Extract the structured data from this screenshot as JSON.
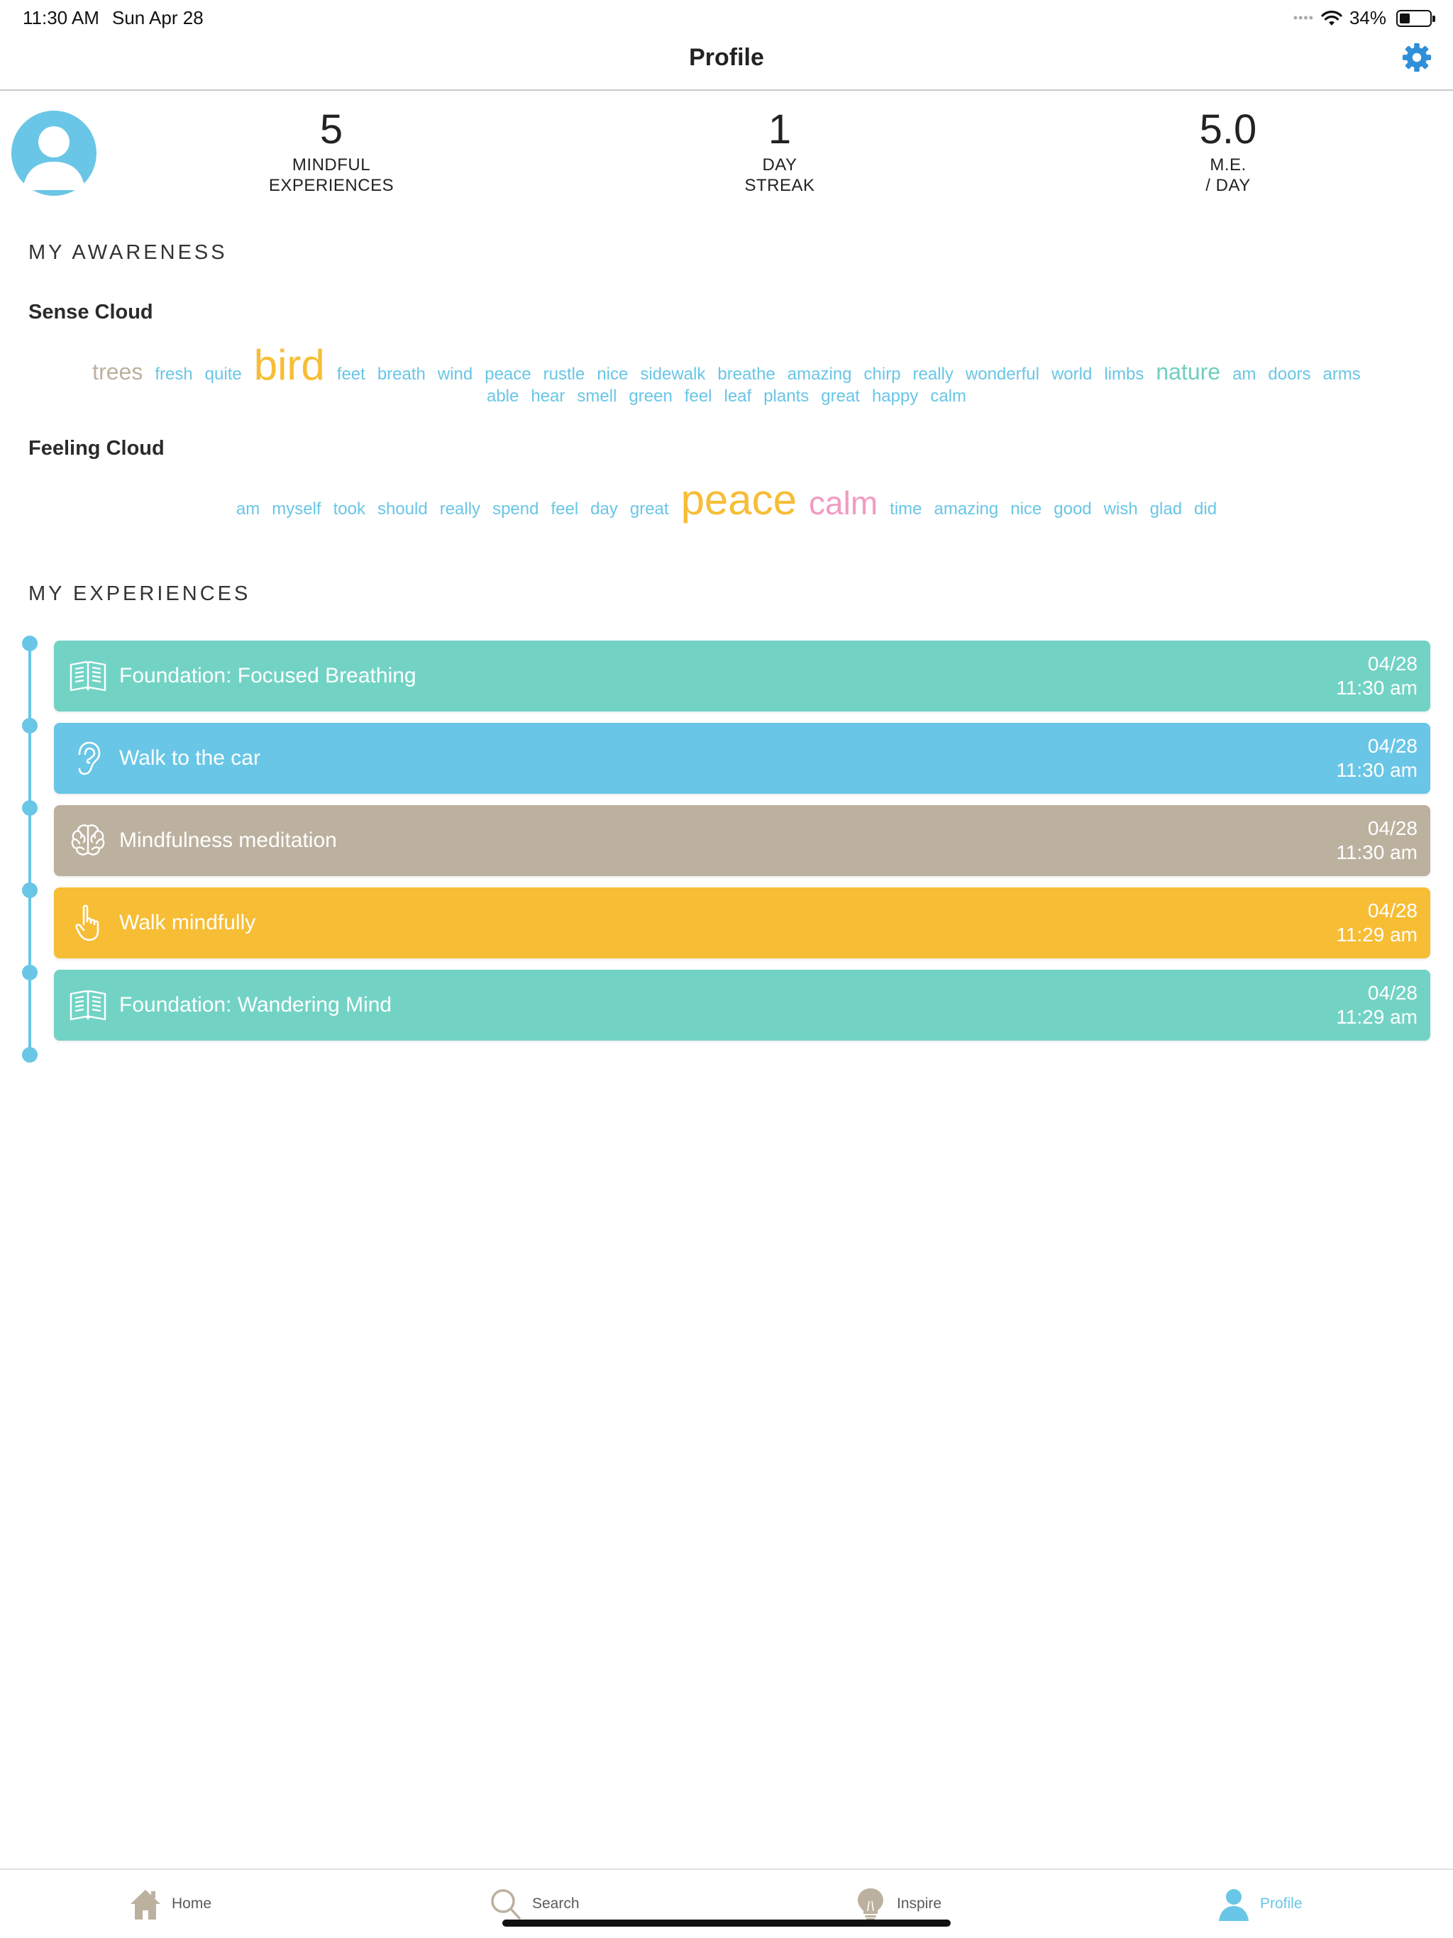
{
  "status_bar": {
    "time": "11:30 AM",
    "date": "Sun Apr 28",
    "battery": "34%",
    "battery_level": 0.34
  },
  "nav": {
    "title": "Profile"
  },
  "stats": [
    {
      "value": "5",
      "label_line1": "MINDFUL",
      "label_line2": "EXPERIENCES"
    },
    {
      "value": "1",
      "label_line1": "DAY",
      "label_line2": "STREAK"
    },
    {
      "value": "5.0",
      "label_line1": "M.E.",
      "label_line2": "/ DAY"
    }
  ],
  "awareness": {
    "heading": "MY AWARENESS",
    "sense_cloud_title": "Sense Cloud",
    "feeling_cloud_title": "Feeling Cloud"
  },
  "sense_cloud": {
    "line1": [
      {
        "text": "trees",
        "size": "md",
        "color": "#bcb19e"
      },
      {
        "text": "fresh"
      },
      {
        "text": "quite"
      },
      {
        "text": "bird",
        "size": "xl",
        "color": "#f7bd35"
      },
      {
        "text": "feet"
      },
      {
        "text": "breath"
      },
      {
        "text": "wind"
      },
      {
        "text": "peace"
      },
      {
        "text": "rustle"
      },
      {
        "text": "nice"
      },
      {
        "text": "sidewalk"
      },
      {
        "text": "breathe"
      },
      {
        "text": "amazing"
      },
      {
        "text": "chirp"
      },
      {
        "text": "really"
      },
      {
        "text": "wonderful"
      },
      {
        "text": "world"
      },
      {
        "text": "limbs"
      },
      {
        "text": "nature",
        "size": "md",
        "color": "#6fcfbf"
      },
      {
        "text": "am"
      },
      {
        "text": "doors"
      },
      {
        "text": "arms"
      }
    ],
    "line2": [
      {
        "text": "able"
      },
      {
        "text": "hear"
      },
      {
        "text": "smell"
      },
      {
        "text": "green"
      },
      {
        "text": "feel"
      },
      {
        "text": "leaf"
      },
      {
        "text": "plants"
      },
      {
        "text": "great"
      },
      {
        "text": "happy"
      },
      {
        "text": "calm"
      }
    ]
  },
  "feeling_cloud": {
    "line1": [
      {
        "text": "am"
      },
      {
        "text": "myself"
      },
      {
        "text": "took"
      },
      {
        "text": "should"
      },
      {
        "text": "really"
      },
      {
        "text": "spend"
      },
      {
        "text": "feel"
      },
      {
        "text": "day"
      },
      {
        "text": "great"
      },
      {
        "text": "peace",
        "size": "xl",
        "color": "#f7bd35"
      },
      {
        "text": "calm",
        "size": "lg",
        "color": "#f29bc0"
      },
      {
        "text": "time"
      },
      {
        "text": "amazing"
      },
      {
        "text": "nice"
      },
      {
        "text": "good"
      },
      {
        "text": "wish"
      },
      {
        "text": "glad"
      },
      {
        "text": "did"
      }
    ]
  },
  "experiences": {
    "heading": "MY EXPERIENCES",
    "items": [
      {
        "title": "Foundation: Focused Breathing",
        "date": "04/28",
        "time": "11:30 am",
        "color": "#72d3c5",
        "icon": "book-icon"
      },
      {
        "title": "Walk to the car",
        "date": "04/28",
        "time": "11:30 am",
        "color": "#69c6e6",
        "icon": "ear-icon"
      },
      {
        "title": "Mindfulness meditation",
        "date": "04/28",
        "time": "11:30 am",
        "color": "#bcb19e",
        "icon": "brain-icon"
      },
      {
        "title": "Walk mindfully",
        "date": "04/28",
        "time": "11:29 am",
        "color": "#f7bd35",
        "icon": "hand-pointer-icon"
      },
      {
        "title": "Foundation: Wandering Mind",
        "date": "04/28",
        "time": "11:29 am",
        "color": "#72d3c5",
        "icon": "book-icon"
      }
    ]
  },
  "tabs": [
    {
      "label": "Home",
      "icon": "home-icon"
    },
    {
      "label": "Search",
      "icon": "search-icon"
    },
    {
      "label": "Inspire",
      "icon": "lightbulb-icon"
    },
    {
      "label": "Profile",
      "icon": "profile-icon",
      "active": true
    }
  ],
  "colors": {
    "accent": "#69c6e6",
    "gear": "#2f8fd8",
    "tab_inactive": "#bcb19e"
  }
}
